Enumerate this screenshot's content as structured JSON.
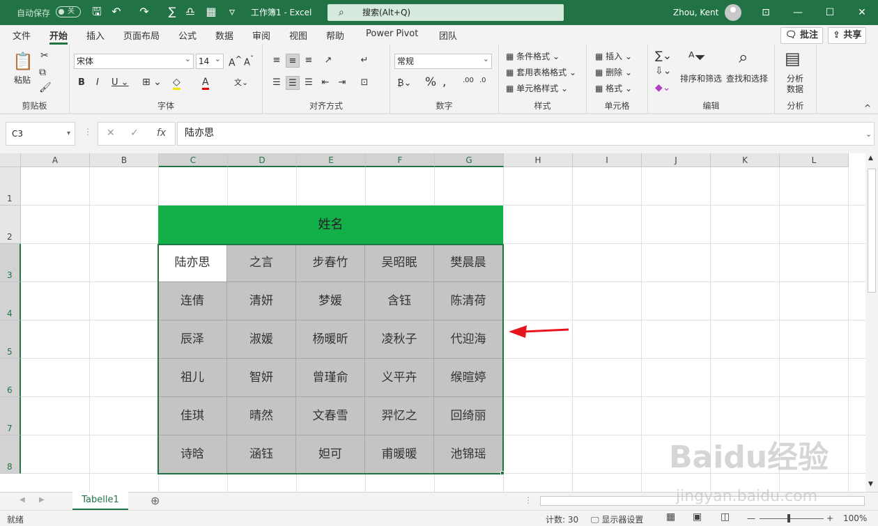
{
  "titlebar": {
    "autosave_label": "自动保存",
    "autosave_state": "关",
    "doc_title": "工作簿1 - Excel",
    "search_placeholder": "搜索(Alt+Q)",
    "user_name": "Zhou, Kent",
    "accent": "#217346"
  },
  "menus": [
    "文件",
    "开始",
    "插入",
    "页面布局",
    "公式",
    "数据",
    "审阅",
    "视图",
    "帮助",
    "Power Pivot",
    "团队"
  ],
  "active_menu": "开始",
  "share": {
    "comment_label": "批注",
    "share_label": "共享"
  },
  "ribbon": {
    "clipboard": {
      "paste": "粘贴",
      "label": "剪贴板"
    },
    "font": {
      "name": "宋体",
      "size": "14",
      "label": "字体"
    },
    "alignment": {
      "label": "对齐方式"
    },
    "number": {
      "format": "常规",
      "label": "数字"
    },
    "styles": {
      "conditional": "条件格式",
      "table": "套用表格格式",
      "cell": "单元格样式",
      "label": "样式"
    },
    "cells": {
      "insert": "插入",
      "delete": "删除",
      "format": "格式",
      "label": "单元格"
    },
    "editing": {
      "sort": "排序和筛选",
      "find": "查找和选择",
      "label": "编辑"
    },
    "analysis": {
      "analyze1": "分析",
      "analyze2": "数据",
      "label": "分析"
    }
  },
  "formula_bar": {
    "name_box": "C3",
    "value": "陆亦思"
  },
  "columns": [
    "A",
    "B",
    "C",
    "D",
    "E",
    "F",
    "G",
    "H",
    "I",
    "J",
    "K",
    "L"
  ],
  "rows": [
    "1",
    "2",
    "3",
    "4",
    "5",
    "6",
    "7",
    "8"
  ],
  "table": {
    "header": "姓名",
    "header_color": "#13b04a",
    "cells": [
      [
        "陆亦思",
        "之言",
        "步春竹",
        "吴昭眠",
        "樊晨晨"
      ],
      [
        "连倩",
        "清妍",
        "梦媛",
        "含钰",
        "陈清荷"
      ],
      [
        "辰泽",
        "淑媛",
        "杨暖昕",
        "凌秋子",
        "代迎海"
      ],
      [
        "祖儿",
        "智妍",
        "曾瑾俞",
        "义平卉",
        "缑暄婷"
      ],
      [
        "佳琪",
        "晴然",
        "文春雪",
        "羿忆之",
        "回绮丽"
      ],
      [
        "诗晗",
        "涵钰",
        "妲可",
        "甫暖暖",
        "池锦瑶"
      ]
    ]
  },
  "sheet_tab": "Tabelle1",
  "status": {
    "ready": "就绪",
    "count": "计数: 30",
    "display_settings": "显示器设置",
    "zoom": "100%"
  },
  "watermark": {
    "line1": "Baidu经验",
    "line2": "jingyan.baidu.com"
  }
}
